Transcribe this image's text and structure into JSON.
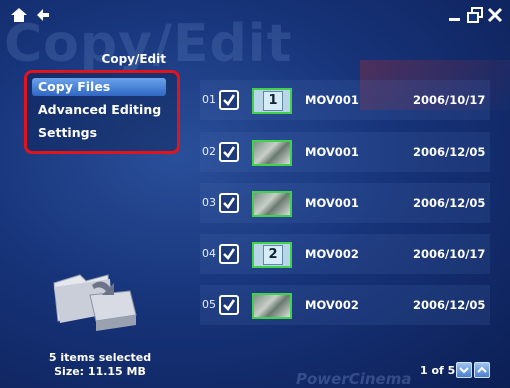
{
  "app": {
    "watermark_title": "Copy/Edit",
    "page_title": "Copy/Edit",
    "brand_watermark": "PowerCinema"
  },
  "topbar": {
    "home_icon": "home-icon",
    "back_icon": "back-arrow-icon",
    "minimize_icon": "minimize-icon",
    "restore_icon": "restore-icon",
    "close_icon": "close-icon"
  },
  "menu": {
    "items": [
      {
        "label": "Copy Files",
        "selected": true
      },
      {
        "label": "Advanced Editing",
        "selected": false
      },
      {
        "label": "Settings",
        "selected": false
      }
    ],
    "highlight_color": "#e0141c"
  },
  "rows": [
    {
      "num": "01",
      "checked": true,
      "thumb": "1",
      "name": "MOV001",
      "date": "2006/10/17"
    },
    {
      "num": "02",
      "checked": true,
      "thumb": "",
      "name": "MOV001",
      "date": "2006/12/05"
    },
    {
      "num": "03",
      "checked": true,
      "thumb": "",
      "name": "MOV001",
      "date": "2006/12/05"
    },
    {
      "num": "04",
      "checked": true,
      "thumb": "2",
      "name": "MOV002",
      "date": "2006/10/17"
    },
    {
      "num": "05",
      "checked": true,
      "thumb": "",
      "name": "MOV002",
      "date": "2006/12/05"
    }
  ],
  "status": {
    "selected": "5 items selected",
    "size": "Size:  11.15 MB"
  },
  "pager": {
    "text": "1 of 5",
    "down_icon": "chevron-down-icon",
    "up_icon": "chevron-up-icon"
  },
  "colors": {
    "thumb_border": "#3fd24a",
    "background": "#17347a"
  }
}
